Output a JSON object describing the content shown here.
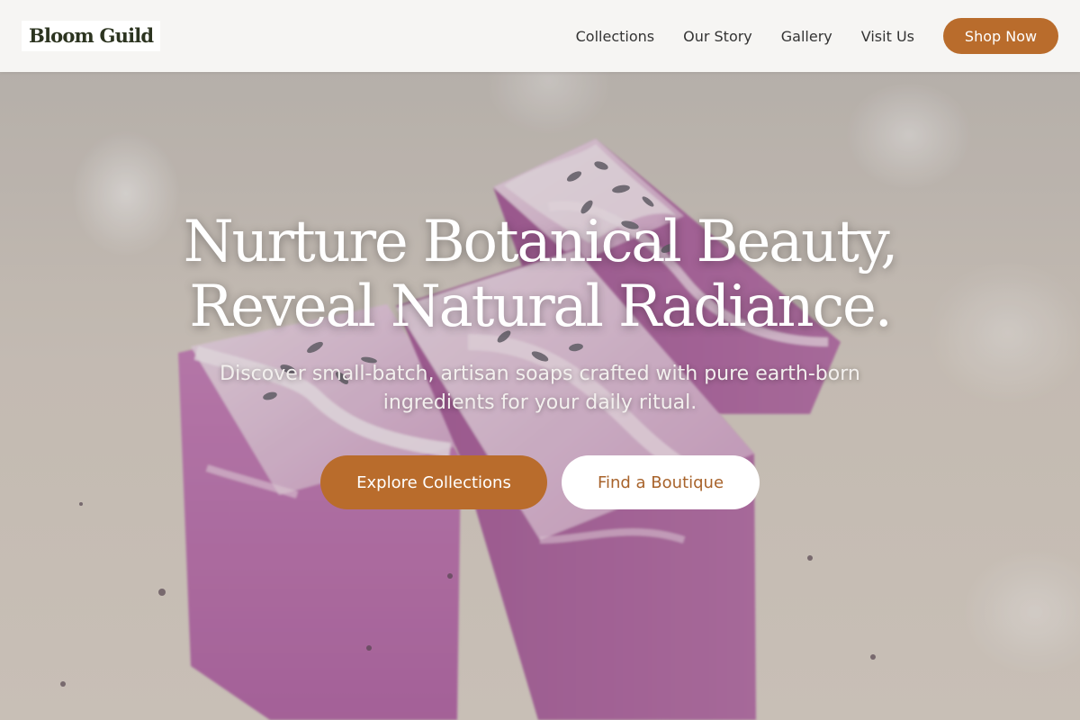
{
  "brand": {
    "name": "Bloom Guild"
  },
  "nav": {
    "links": [
      "Collections",
      "Our Story",
      "Gallery",
      "Visit Us"
    ],
    "cta": "Shop Now"
  },
  "hero": {
    "title_lines": [
      "Nurture Botanical Beauty,",
      "Reveal Natural Radiance."
    ],
    "subtitle": "Discover small-batch, artisan soaps crafted with pure earth-born ingredients for your daily ritual.",
    "primary_cta": "Explore Collections",
    "secondary_cta": "Find a Boutique"
  },
  "colors": {
    "accent": "#b96c2c",
    "header_bg": "#f6f5f3",
    "logo_text": "#2c3420",
    "nav_text": "#333333",
    "hero_text": "#ffffff",
    "soap_purple": "#c07cb0"
  }
}
